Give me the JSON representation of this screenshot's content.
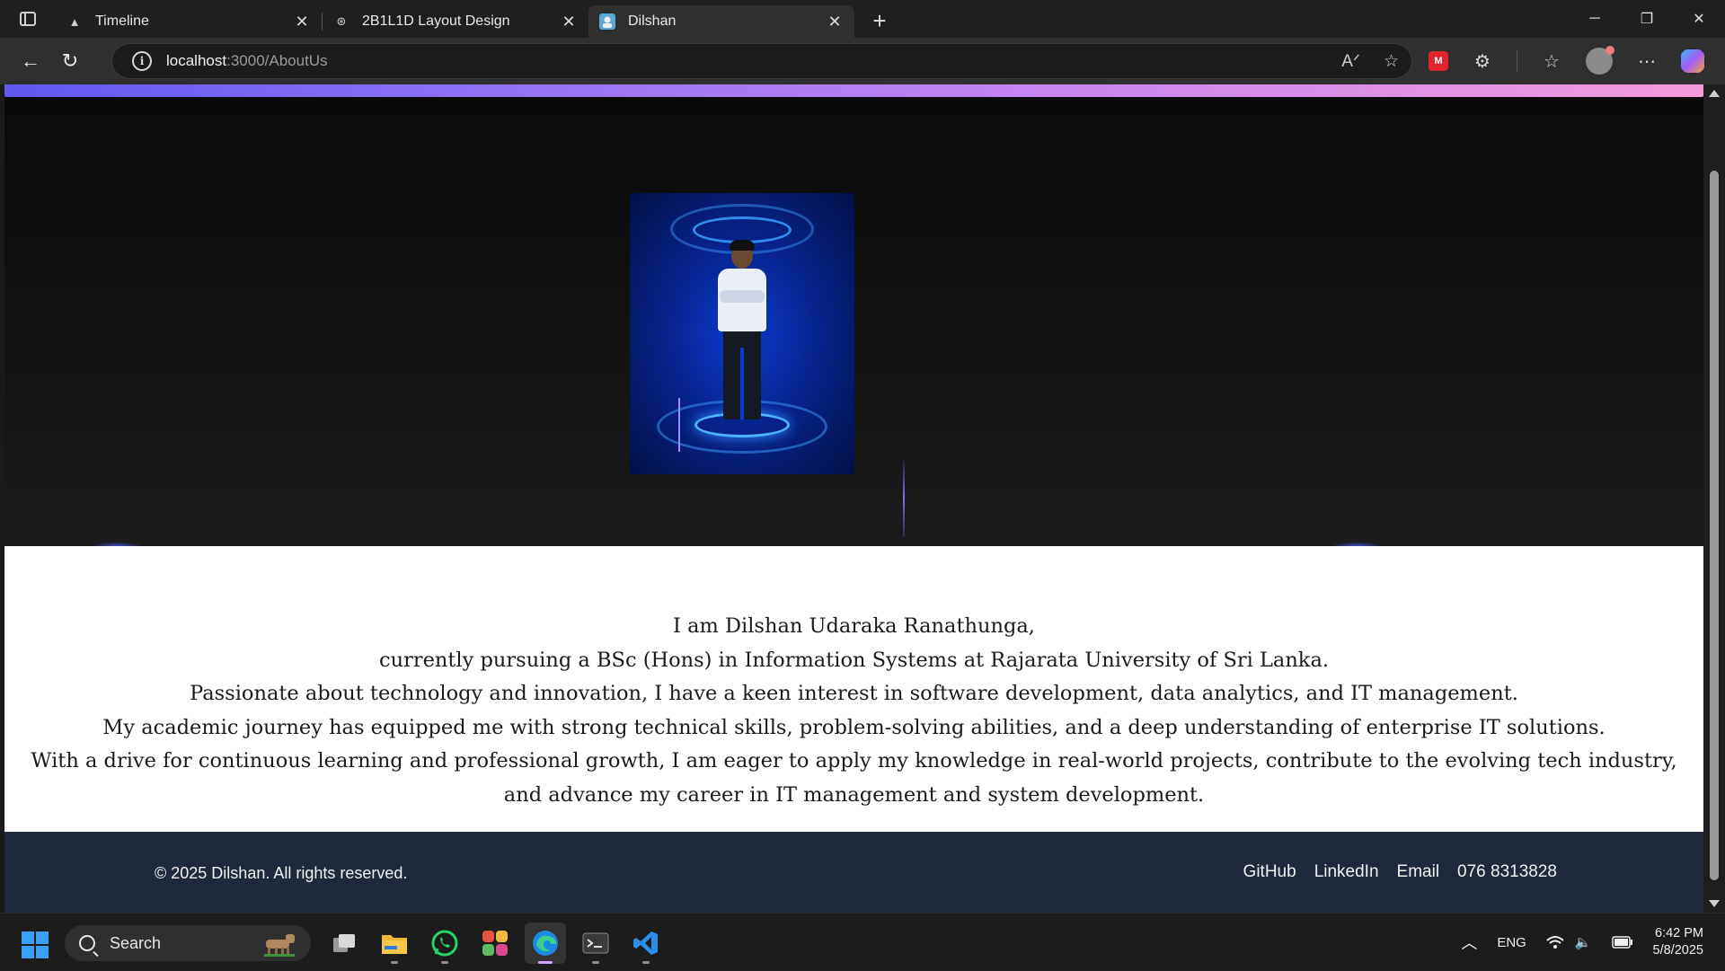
{
  "browser": {
    "tabs": [
      {
        "title": "Timeline",
        "favicon": "vercel-icon",
        "active": false
      },
      {
        "title": "2B1L1D Layout Design",
        "favicon": "openai-icon",
        "active": false
      },
      {
        "title": "Dilshan",
        "favicon": "site-icon",
        "active": true
      }
    ],
    "url_host": "localhost",
    "url_path": ":3000/AboutUs"
  },
  "page": {
    "about_lines": [
      "I am Dilshan Udaraka Ranathunga,",
      "currently pursuing a BSc (Hons) in Information Systems at Rajarata University of Sri Lanka.",
      "Passionate about technology and innovation, I have a keen interest in software development, data analytics, and IT management.",
      "My academic journey has equipped me with strong technical skills, problem-solving abilities, and a deep understanding of enterprise IT solutions.",
      "With a drive for continuous learning and professional growth, I am eager to apply my knowledge in real-world projects, contribute to the evolving tech industry,",
      "and advance my career in IT management and system development."
    ],
    "footer": {
      "copyright": "© 2025 Dilshan. All rights reserved.",
      "links": [
        "GitHub",
        "LinkedIn",
        "Email",
        "076 8313828"
      ]
    },
    "colors": {
      "accent_gradient_start": "#6259f0",
      "accent_gradient_end": "#f49ad9",
      "footer_bg": "#1e293b"
    }
  },
  "taskbar": {
    "search_label": "Search",
    "language": "ENG",
    "time": "6:42 PM",
    "date": "5/8/2025"
  }
}
